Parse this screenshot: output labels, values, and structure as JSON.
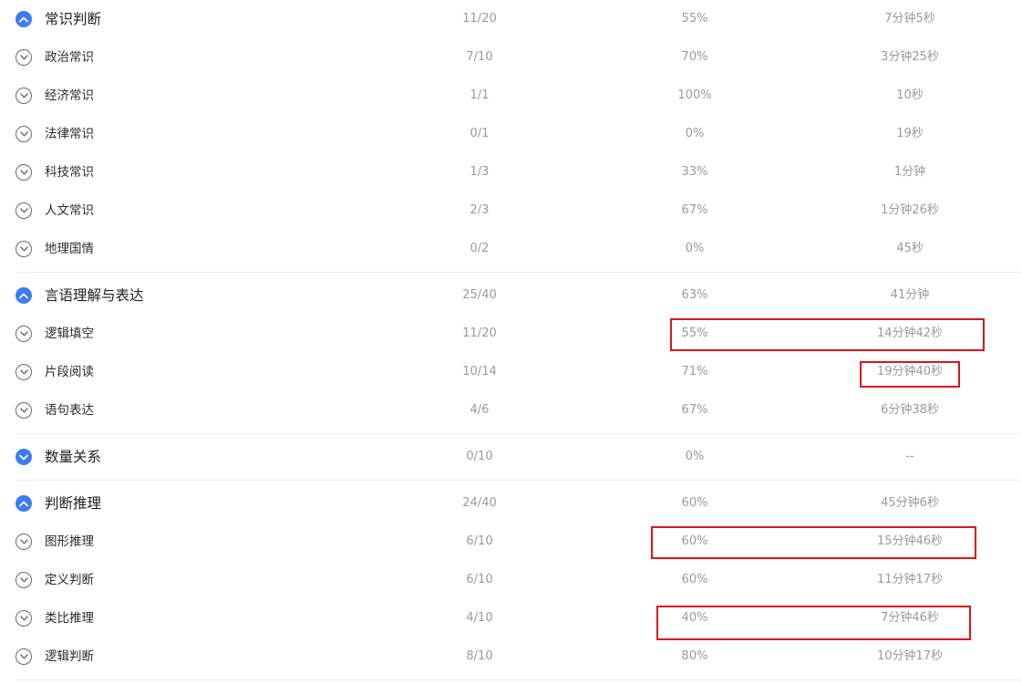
{
  "colors": {
    "accent_blue": "#3b7cf5",
    "highlight_red": "#e01414",
    "muted_text": "#9a9a9a",
    "divider": "#ececec"
  },
  "groups": [
    {
      "name": "常识判断",
      "ratio": "11/20",
      "pct": "55%",
      "time": "7分钟5秒",
      "expanded": true,
      "children": [
        {
          "name": "政治常识",
          "ratio": "7/10",
          "pct": "70%",
          "time": "3分钟25秒"
        },
        {
          "name": "经济常识",
          "ratio": "1/1",
          "pct": "100%",
          "time": "10秒"
        },
        {
          "name": "法律常识",
          "ratio": "0/1",
          "pct": "0%",
          "time": "19秒"
        },
        {
          "name": "科技常识",
          "ratio": "1/3",
          "pct": "33%",
          "time": "1分钟"
        },
        {
          "name": "人文常识",
          "ratio": "2/3",
          "pct": "67%",
          "time": "1分钟26秒"
        },
        {
          "name": "地理国情",
          "ratio": "0/2",
          "pct": "0%",
          "time": "45秒"
        }
      ]
    },
    {
      "name": "言语理解与表达",
      "ratio": "25/40",
      "pct": "63%",
      "time": "41分钟",
      "expanded": true,
      "children": [
        {
          "name": "逻辑填空",
          "ratio": "11/20",
          "pct": "55%",
          "time": "14分钟42秒"
        },
        {
          "name": "片段阅读",
          "ratio": "10/14",
          "pct": "71%",
          "time": "19分钟40秒"
        },
        {
          "name": "语句表达",
          "ratio": "4/6",
          "pct": "67%",
          "time": "6分钟38秒"
        }
      ]
    },
    {
      "name": "数量关系",
      "ratio": "0/10",
      "pct": "0%",
      "time": "--",
      "expanded": false,
      "children": []
    },
    {
      "name": "判断推理",
      "ratio": "24/40",
      "pct": "60%",
      "time": "45分钟6秒",
      "expanded": true,
      "children": [
        {
          "name": "图形推理",
          "ratio": "6/10",
          "pct": "60%",
          "time": "15分钟46秒"
        },
        {
          "name": "定义判断",
          "ratio": "6/10",
          "pct": "60%",
          "time": "11分钟17秒"
        },
        {
          "name": "类比推理",
          "ratio": "4/10",
          "pct": "40%",
          "time": "7分钟46秒"
        },
        {
          "name": "逻辑判断",
          "ratio": "8/10",
          "pct": "80%",
          "time": "10分钟17秒"
        }
      ]
    }
  ]
}
